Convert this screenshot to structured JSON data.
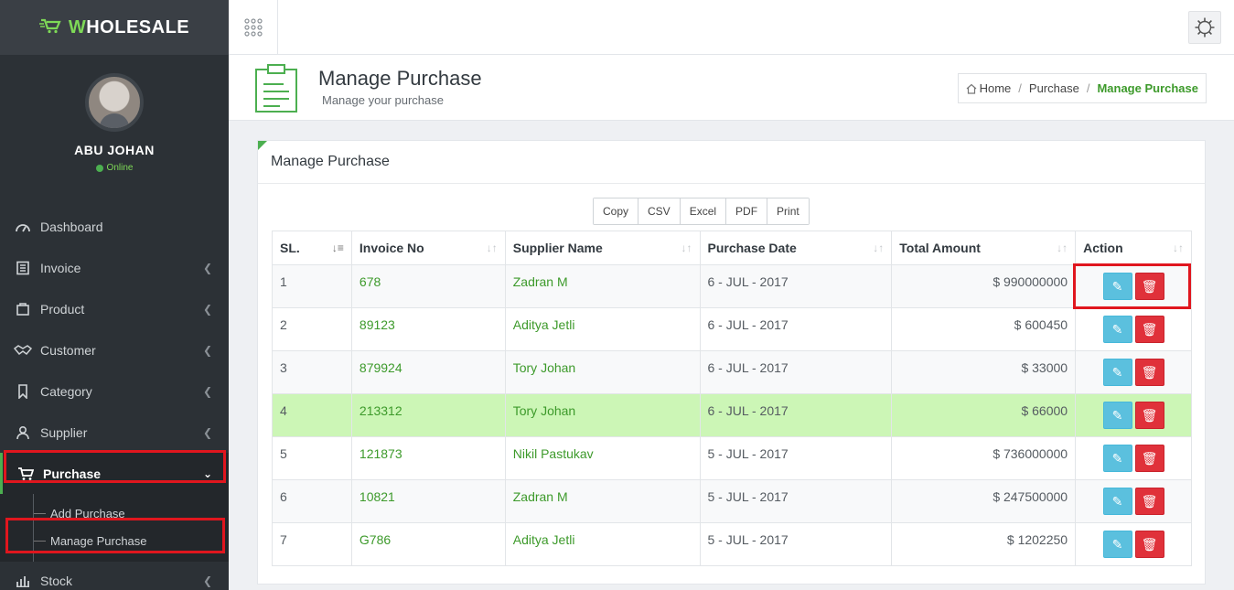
{
  "brand": {
    "name_prefix": "W",
    "name_rest": "HOLESALE"
  },
  "user": {
    "name": "ABU JOHAN",
    "status": "Online"
  },
  "sidebar": {
    "items": [
      {
        "label": "Dashboard",
        "icon": "dashboard-icon"
      },
      {
        "label": "Invoice",
        "icon": "invoice-icon"
      },
      {
        "label": "Product",
        "icon": "product-icon"
      },
      {
        "label": "Customer",
        "icon": "handshake-icon"
      },
      {
        "label": "Category",
        "icon": "tag-icon"
      },
      {
        "label": "Supplier",
        "icon": "user-icon"
      },
      {
        "label": "Purchase",
        "icon": "cart-icon"
      },
      {
        "label": "Stock",
        "icon": "bar-chart-icon"
      }
    ],
    "purchase_sub": [
      "Add Purchase",
      "Manage Purchase"
    ]
  },
  "page": {
    "title": "Manage Purchase",
    "subtitle": "Manage your purchase"
  },
  "breadcrumb": {
    "home": "Home",
    "section": "Purchase",
    "current": "Manage Purchase"
  },
  "panel": {
    "title": "Manage Purchase"
  },
  "export_buttons": [
    "Copy",
    "CSV",
    "Excel",
    "PDF",
    "Print"
  ],
  "table": {
    "columns": [
      "SL.",
      "Invoice No",
      "Supplier Name",
      "Purchase Date",
      "Total Amount",
      "Action"
    ],
    "rows": [
      {
        "sl": "1",
        "invoice": "678",
        "supplier": "Zadran M",
        "date": "6 - JUL - 2017",
        "amount": "$ 990000000"
      },
      {
        "sl": "2",
        "invoice": "89123",
        "supplier": "Aditya Jetli",
        "date": "6 - JUL - 2017",
        "amount": "$ 600450"
      },
      {
        "sl": "3",
        "invoice": "879924",
        "supplier": "Tory Johan",
        "date": "6 - JUL - 2017",
        "amount": "$ 33000"
      },
      {
        "sl": "4",
        "invoice": "213312",
        "supplier": "Tory Johan",
        "date": "6 - JUL - 2017",
        "amount": "$ 66000"
      },
      {
        "sl": "5",
        "invoice": "121873",
        "supplier": "Nikil Pastukav",
        "date": "5 - JUL - 2017",
        "amount": "$ 736000000"
      },
      {
        "sl": "6",
        "invoice": "10821",
        "supplier": "Zadran M",
        "date": "5 - JUL - 2017",
        "amount": "$ 247500000"
      },
      {
        "sl": "7",
        "invoice": "G786",
        "supplier": "Aditya Jetli",
        "date": "5 - JUL - 2017",
        "amount": "$ 1202250"
      }
    ]
  },
  "colors": {
    "accent": "#4caf50",
    "link": "#3d9a2b",
    "highlight_row": "#ccf6b6",
    "edit": "#5bc0de",
    "delete": "#e0313a",
    "annotation": "#e0161e"
  }
}
